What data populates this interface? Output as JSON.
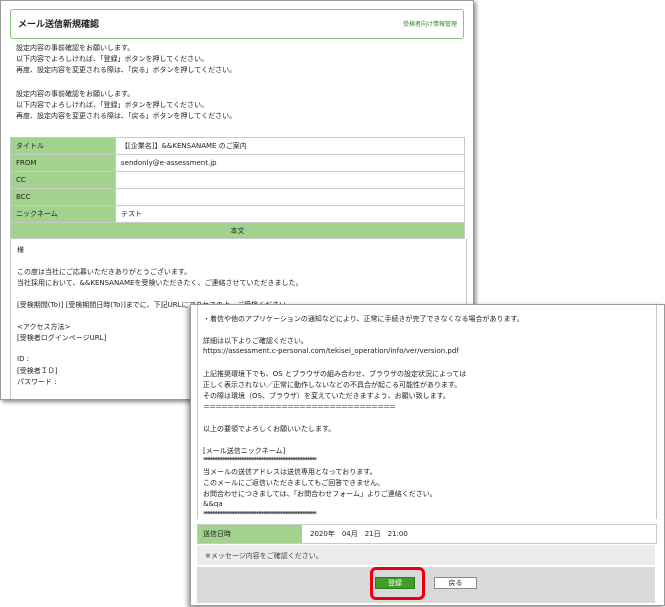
{
  "window1": {
    "title": "メール送信新規確認",
    "header_link": "受検者向け情報管理",
    "intro": [
      "設定内容の事前確認をお願いします。",
      "以下内容でよろしければ、「登録」ボタンを押してください。",
      "再度、設定内容を変更される際は、「戻る」ボタンを押してください。",
      "",
      "設定内容の事前確認をお願いします。",
      "以下内容でよろしければ、「登録」ボタンを押してください。",
      "再度、設定内容を変更される際は、「戻る」ボタンを押してください。"
    ],
    "fields": [
      {
        "label": "タイトル",
        "value": "【[企業名]】&&KENSANAME のご案内"
      },
      {
        "label": "FROM",
        "value": "sendonly@e-assessment.jp"
      },
      {
        "label": "CC",
        "value": ""
      },
      {
        "label": "BCC",
        "value": ""
      },
      {
        "label": "ニックネーム",
        "value": "テスト"
      }
    ],
    "body_header": "本文",
    "body_lines": [
      "様",
      "",
      "この度は当社にご応募いただきありがとうございます。",
      "当社採用において、&&KENSANAMEを受検いただきたく、ご連絡させていただきました。",
      "",
      "[受検期間(To)] [受検期間日時(To)]までに、下記URLにアクセスの上、ご受検ください。",
      "",
      "<アクセス方法>",
      "[受検者ログインページURL]",
      "",
      "ID :",
      "[受検者ＩＤ]",
      "パスワード :"
    ]
  },
  "window2": {
    "lines": [
      "・着信や他のアプリケーションの通知などにより、正常に手続きが完了できなくなる場合があります。",
      "",
      "詳細は以下よりご確認ください。",
      "https://assessment.c-personal.com/tekisei_operation/info/ver/version.pdf",
      "",
      "上記推奨環境下でも、OS とブラウザの組み合わせ、ブラウザの設定状況によっては",
      "正しく表示されない／正常に動作しないなどの不具合が起こる可能性があります。",
      "その際は環境（OS、ブラウザ）を変えていただきますよう、お願い致します。",
      "＝＝＝＝＝＝＝＝＝＝＝＝＝＝＝＝＝＝＝＝＝＝＝＝＝＝＝＝＝＝＝＝",
      "",
      "以上の要領でよろしくお願いいたします。",
      "",
      "[メール送信ニックネーム]",
      "******************************************************************",
      "当メールの送信アドレスは送信専用となっております。",
      "このメールにご返信いただきましてもご回答できません。",
      "お問合わせにつきましては、「お問合わせフォーム」よりご連絡ください。",
      "&&qa",
      "******************************************************************"
    ],
    "send_datetime_label": "送信日時",
    "send_datetime_value": "2020年　04月　21日　21:00",
    "notice": "※メッセージ内容をご確認ください。",
    "register_button": "登録",
    "back_button": "戻る"
  },
  "colors": {
    "accent_green": "#a3d18e",
    "button_green": "#3f9e2a",
    "highlight_red": "#e8000d"
  }
}
